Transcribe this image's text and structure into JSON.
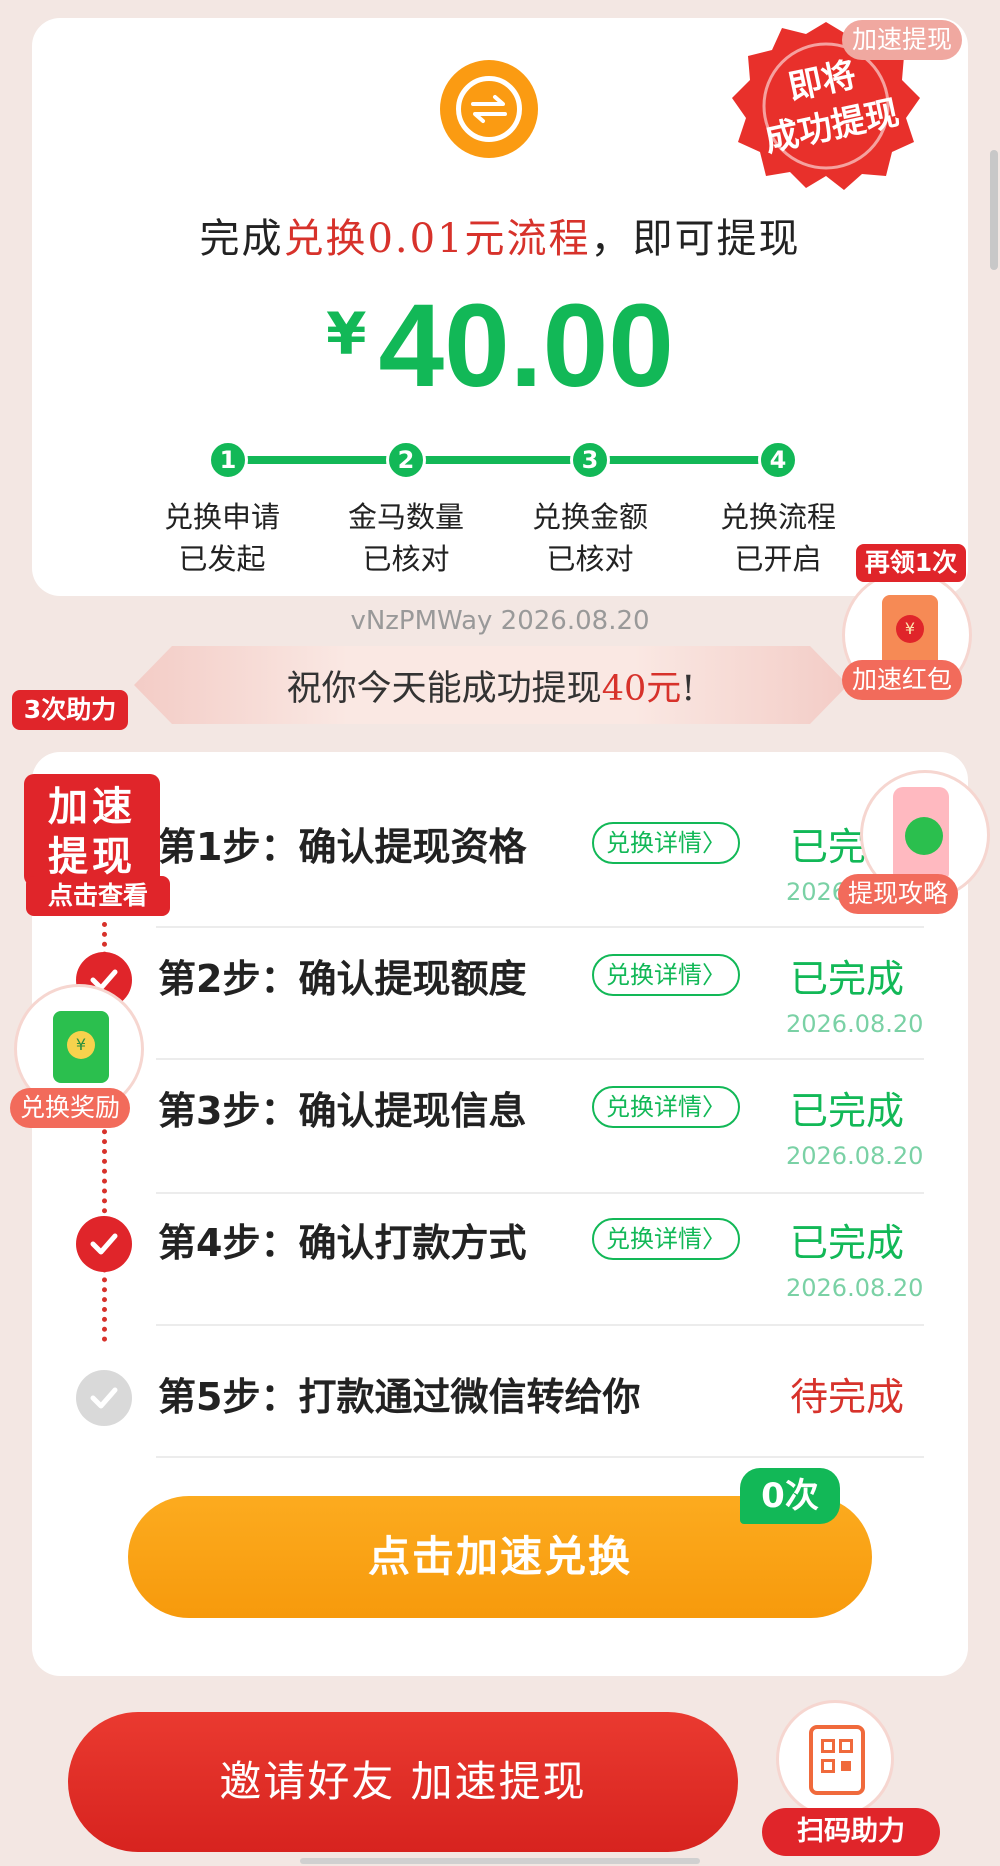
{
  "headline": {
    "prefix": "完成",
    "highlight": "兑换0.01元流程",
    "suffix": "，即可提现"
  },
  "amount": {
    "currency": "¥",
    "value": "40.00"
  },
  "progress": {
    "steps": [
      {
        "num": "1",
        "line1": "兑换申请",
        "line2": "已发起"
      },
      {
        "num": "2",
        "line1": "金马数量",
        "line2": "已核对"
      },
      {
        "num": "3",
        "line1": "兑换金额",
        "line2": "已核对"
      },
      {
        "num": "4",
        "line1": "兑换流程",
        "line2": "已开启"
      }
    ]
  },
  "version_text": "vNzPMWay 2026.08.20",
  "banner": {
    "prefix": "祝你今天能成功提现",
    "highlight": "40元",
    "suffix": "!"
  },
  "steps": [
    {
      "title": "第1步：确认提现资格",
      "detail": "兑换详情〉",
      "status": "已完成",
      "date": "2026.08.20"
    },
    {
      "title": "第2步：确认提现额度",
      "detail": "兑换详情〉",
      "status": "已完成",
      "date": "2026.08.20"
    },
    {
      "title": "第3步：确认提现信息",
      "detail": "兑换详情〉",
      "status": "已完成",
      "date": "2026.08.20"
    },
    {
      "title": "第4步：确认打款方式",
      "detail": "兑换详情〉",
      "status": "已完成",
      "date": "2026.08.20"
    },
    {
      "title": "第5步：打款通过微信转给你",
      "detail": "",
      "status": "待完成",
      "date": ""
    }
  ],
  "main_button": "点击加速兑换",
  "count_badge": "0次",
  "invite_button": "邀请好友 加速提现",
  "floating": {
    "seal": {
      "line1": "即将",
      "line2": "成功提现"
    },
    "speed_withdraw": "加速提现",
    "again_label": "再领1次",
    "speed_redpacket": "加速红包",
    "help_count": "3次助力",
    "speed_square": {
      "line1": "加速",
      "line2": "提现"
    },
    "click_view": "点击查看",
    "withdraw_guide": "提现攻略",
    "exchange_reward": "兑换奖励",
    "scan_help": "扫码助力"
  },
  "colors": {
    "green": "#12b857",
    "red": "#d7322b",
    "orange": "#fb9b12",
    "bg": "#f3e7e3"
  },
  "icons": [
    "swap-icon",
    "check-icon",
    "wechat-icon",
    "qr-code-icon",
    "red-packet-icon",
    "yuan-icon"
  ]
}
